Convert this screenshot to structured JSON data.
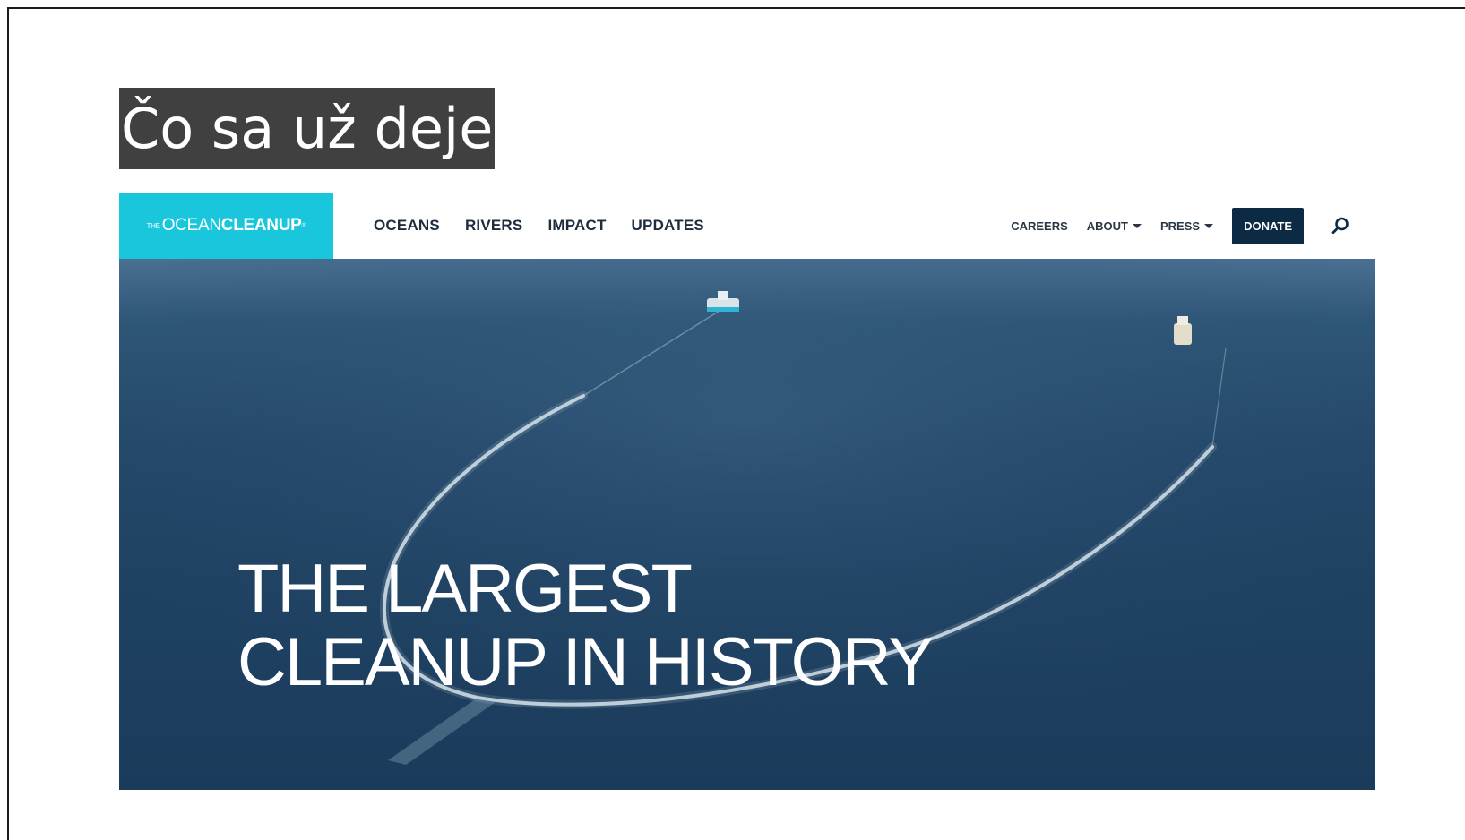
{
  "slide": {
    "title": "Čo sa už deje"
  },
  "site": {
    "logo": {
      "the": "THE",
      "part1": "OCEAN",
      "part2": "CLEANUP",
      "mark": "®"
    },
    "primary_nav": [
      "OCEANS",
      "RIVERS",
      "IMPACT",
      "UPDATES"
    ],
    "secondary_nav": {
      "careers": "CAREERS",
      "about": "ABOUT",
      "press": "PRESS",
      "donate": "DONATE"
    },
    "hero": {
      "line1": "THE LARGEST",
      "line2": "CLEANUP IN HISTORY"
    }
  },
  "colors": {
    "logo_bg": "#19c6dc",
    "donate_bg": "#0c2a44",
    "title_bg": "#404040",
    "ocean": "#1f4263"
  },
  "icons": [
    "search-icon",
    "caret-down-icon"
  ]
}
